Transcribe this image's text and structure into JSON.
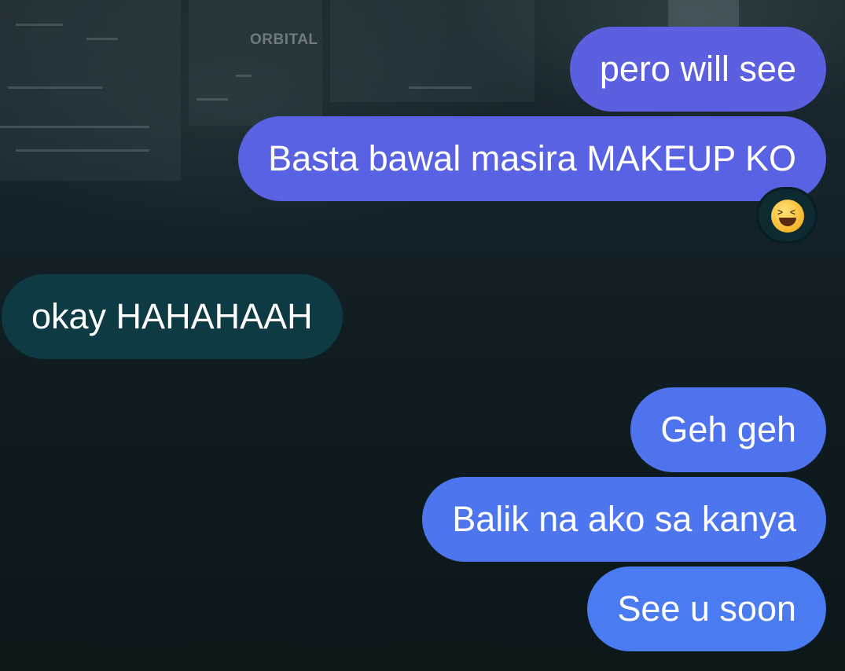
{
  "background": {
    "billboard_text": "ORBITAL"
  },
  "messages": [
    {
      "id": "m1",
      "direction": "sent",
      "text": "pero will see",
      "color": "#5b5fe0"
    },
    {
      "id": "m2",
      "direction": "sent",
      "text": "Basta bawal masira MAKEUP KO",
      "color": "#5862e2"
    },
    {
      "id": "m3",
      "direction": "received",
      "text": "okay HAHAHAAH",
      "color": "#0e3a44"
    },
    {
      "id": "m4",
      "direction": "sent",
      "text": "Geh geh",
      "color": "#4e73ec"
    },
    {
      "id": "m5",
      "direction": "sent",
      "text": "Balik na ako sa kanya",
      "color": "#4d76ee"
    },
    {
      "id": "m6",
      "direction": "sent",
      "text": "See u soon",
      "color": "#4b7bf0"
    }
  ],
  "reaction": {
    "on_message": "m2",
    "emoji": "laughing-squinting-face-icon"
  }
}
